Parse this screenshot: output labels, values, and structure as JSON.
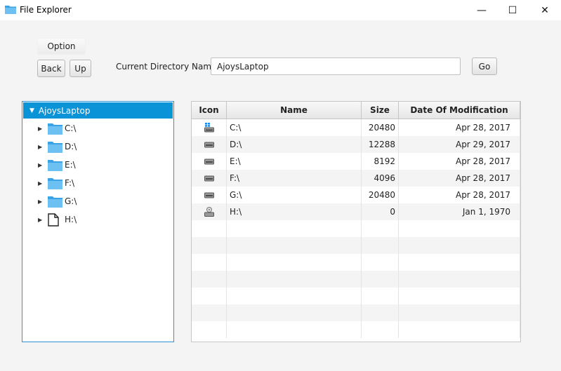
{
  "window": {
    "title": "File Explorer",
    "minimize_glyph": "—",
    "maximize_glyph": "☐",
    "close_glyph": "✕"
  },
  "toolbar": {
    "option_label": "Option",
    "back_label": "Back",
    "up_label": "Up",
    "directory_label": "Current Directory Name",
    "directory_value": "AjoysLaptop",
    "go_label": "Go"
  },
  "tree": {
    "root": {
      "label": "AjoysLaptop",
      "icon": "expanded-arrow-icon"
    },
    "items": [
      {
        "label": "C:\\",
        "icon": "folder-icon"
      },
      {
        "label": "D:\\",
        "icon": "folder-icon"
      },
      {
        "label": "E:\\",
        "icon": "folder-icon"
      },
      {
        "label": "F:\\",
        "icon": "folder-icon"
      },
      {
        "label": "G:\\",
        "icon": "folder-icon"
      },
      {
        "label": "H:\\",
        "icon": "file-icon"
      }
    ]
  },
  "table": {
    "columns": [
      "Icon",
      "Name",
      "Size",
      "Date Of Modification"
    ],
    "rows": [
      {
        "icon": "system-drive-icon",
        "name": "C:\\",
        "size": "20480",
        "date": "Apr 28, 2017"
      },
      {
        "icon": "drive-icon",
        "name": "D:\\",
        "size": "12288",
        "date": "Apr 29, 2017"
      },
      {
        "icon": "drive-icon",
        "name": "E:\\",
        "size": "8192",
        "date": "Apr 28, 2017"
      },
      {
        "icon": "drive-icon",
        "name": "F:\\",
        "size": "4096",
        "date": "Apr 28, 2017"
      },
      {
        "icon": "drive-icon",
        "name": "G:\\",
        "size": "20480",
        "date": "Apr 28, 2017"
      },
      {
        "icon": "optical-drive-icon",
        "name": "H:\\",
        "size": "0",
        "date": "Jan 1, 1970"
      }
    ]
  },
  "colors": {
    "accent": "#0a93d6",
    "folder": "#5bb5ea"
  }
}
